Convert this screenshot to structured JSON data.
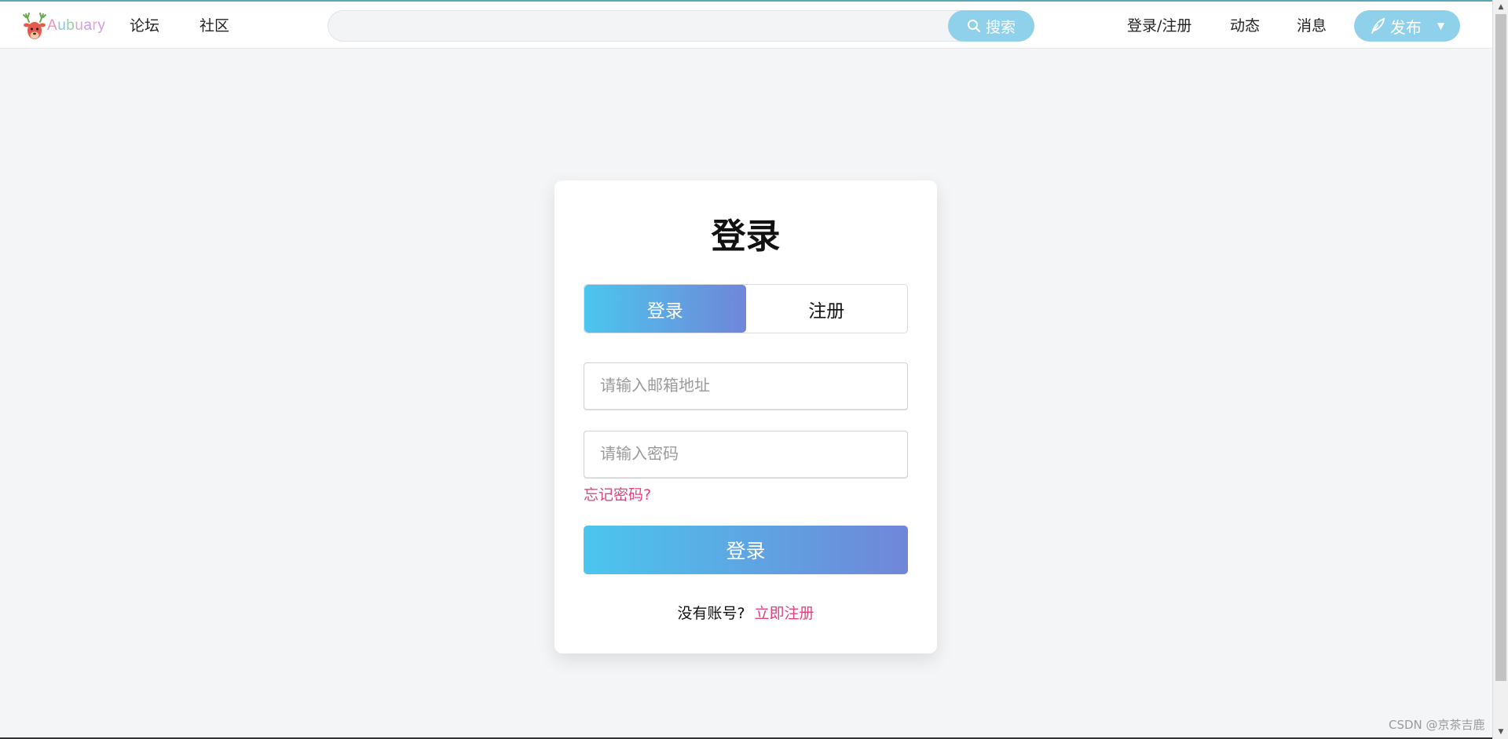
{
  "header": {
    "logo_text": [
      "A",
      "u",
      "b",
      "u",
      "a",
      "r",
      "y"
    ],
    "nav": [
      "论坛",
      "社区"
    ],
    "search": {
      "placeholder": "",
      "button_label": "搜索"
    },
    "right_links": [
      "登录/注册",
      "动态",
      "消息"
    ],
    "publish_label": "发布"
  },
  "login_card": {
    "title": "登录",
    "tabs": [
      {
        "label": "登录",
        "active": true
      },
      {
        "label": "注册",
        "active": false
      }
    ],
    "email_placeholder": "请输入邮箱地址",
    "password_placeholder": "请输入密码",
    "forgot_label": "忘记密码?",
    "submit_label": "登录",
    "no_account_text": "没有账号?",
    "register_link": "立即注册"
  },
  "watermark": "CSDN @京茶吉鹿",
  "colors": {
    "accent": "#8fd0ea",
    "gradient_start": "#4bc6ee",
    "gradient_end": "#7086d8",
    "link_pink": "#e4417f",
    "page_bg": "#f4f5f7"
  },
  "icons": [
    "deer-logo-icon",
    "search-icon",
    "feather-icon",
    "caret-down-icon"
  ]
}
